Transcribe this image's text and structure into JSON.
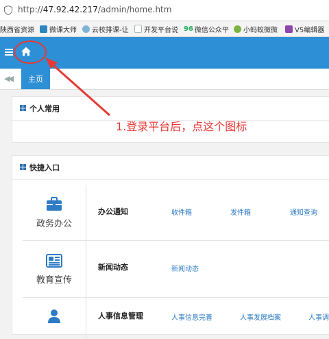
{
  "browser": {
    "url_prefix": "http://",
    "url_host": "47.92.42.217",
    "url_path": "/admin/home.htm",
    "bookmarks": [
      {
        "label": "陕西省资源",
        "color": "#c0392b"
      },
      {
        "label": "微课大师",
        "color": "#2e86c1"
      },
      {
        "label": "云校排课-让",
        "color": "#7fb3d5"
      },
      {
        "label": "开发平台说",
        "color": "#aab7b8"
      },
      {
        "label": "微信公众平",
        "color": "#27ae60"
      },
      {
        "label": "小蚂蚁微微",
        "color": "#7cb342"
      },
      {
        "label": "V5编辑器",
        "color": "#8e44ad"
      }
    ],
    "bookmark_96": "96"
  },
  "colors": {
    "header": "#2d8fd5",
    "annotation": "#e53935",
    "link": "#2d7bc4"
  },
  "header": {
    "menu_icon": "hamburger-icon",
    "home_icon": "home-icon"
  },
  "tabs": {
    "home_label": "主页",
    "back_icon": "double-left-icon"
  },
  "personal": {
    "title": "个人常用"
  },
  "annotation": {
    "text": "1.登录平台后，点这个图标"
  },
  "quick": {
    "title": "快捷入口",
    "rows": [
      {
        "category": "政务办公",
        "icon": "briefcase-icon",
        "title": "办公通知",
        "links": [
          "收件箱",
          "发件箱",
          "通知查询"
        ]
      },
      {
        "category": "教育宣传",
        "icon": "newspaper-icon",
        "title": "新闻动态",
        "links": [
          "新闻动态"
        ]
      },
      {
        "category": "",
        "icon": "user-icon",
        "title": "人事信息管理",
        "links": [
          "人事信息完善",
          "人事发展档案",
          "人事调"
        ]
      }
    ]
  }
}
